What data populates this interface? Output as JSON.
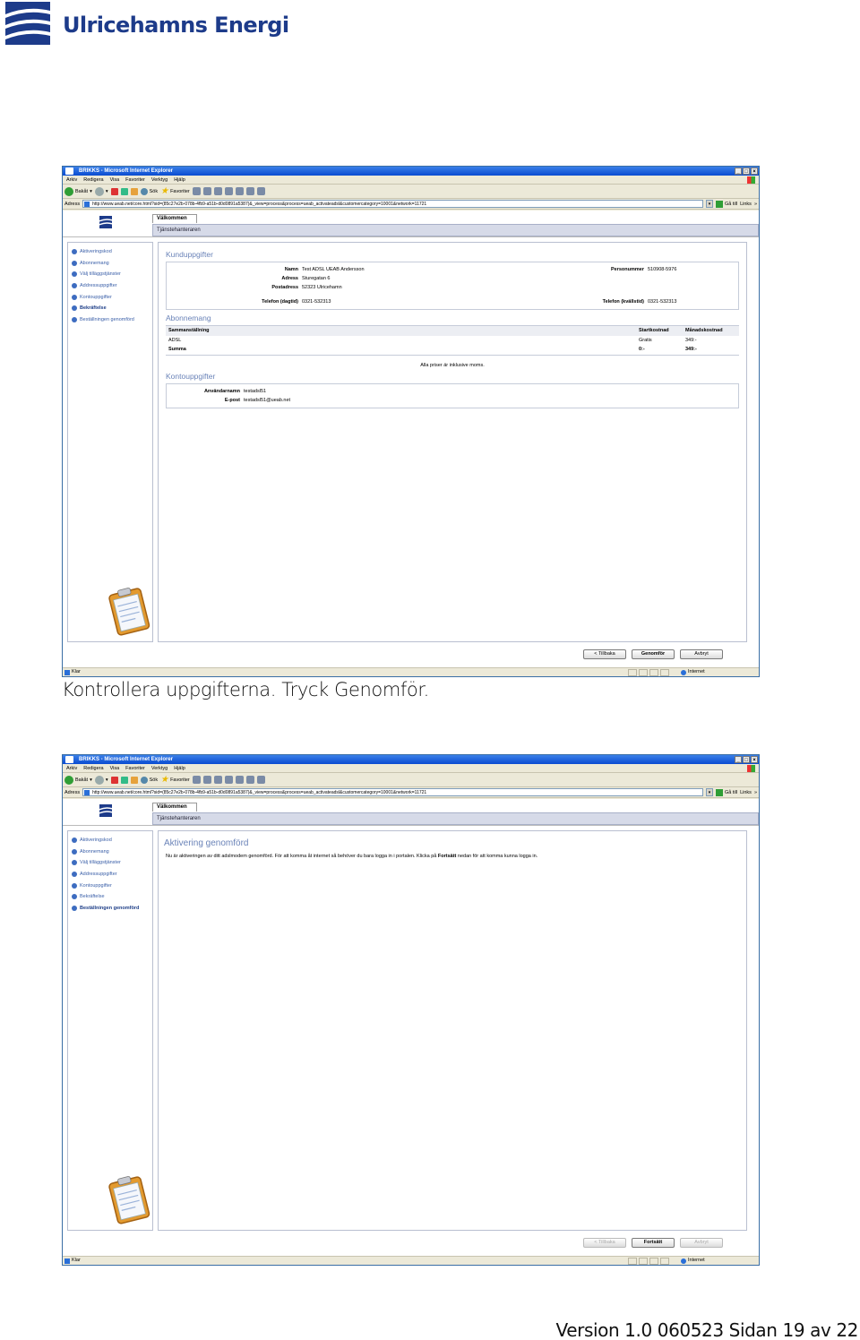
{
  "brand": {
    "name": "Ulricehamns Energi",
    "color": "#1d3b8a"
  },
  "browser": {
    "title": "BRIKKS - Microsoft Internet Explorer",
    "menu": [
      "Arkiv",
      "Redigera",
      "Visa",
      "Favoriter",
      "Verktyg",
      "Hjälp"
    ],
    "toolbar": {
      "back": "Bakåt",
      "search": "Sök",
      "favorites": "Favoriter"
    },
    "address_label": "Adress",
    "url": "http://www.ueab.net/core.html?sid=(85c27e2b-078b-4fb9-a51b-d0d0891a5387)&_view=process&process=ueab_activateadsl&customercategory=10001&network=11721",
    "go_label": "Gå till",
    "links_label": "Links",
    "status_text": "Klar",
    "zone_text": "Internet"
  },
  "portal": {
    "tab": "Välkommen",
    "subtitle": "Tjänstehanteraren",
    "nav": [
      "Aktiveringskod",
      "Abonnemang",
      "Välj tilläggstjänster",
      "Addressuppgifter",
      "Kontouppgifter",
      "Bekräftelse",
      "Beställningen genomförd"
    ]
  },
  "screen1": {
    "customer_section": "Kunduppgifter",
    "name_label": "Namn",
    "name_value": "Test ADSL UEAB Andersson",
    "pnr_label": "Personummer",
    "pnr_value": "510908-5976",
    "address_label": "Adress",
    "address_value": "Sturegatan 6",
    "postal_label": "Postadress",
    "postal_value": "52323 Ulricehamn",
    "phone_day_label": "Telefon (dagtid)",
    "phone_day_value": "0321-532313",
    "phone_eve_label": "Telefon (kvällstid)",
    "phone_eve_value": "0321-532313",
    "subscription_section": "Abonnemang",
    "summary_header": "Sammanställning",
    "start_header": "Startkostnad",
    "monthly_header": "Månadskostnad",
    "item_name": "ADSL",
    "item_start": "Gratis",
    "item_monthly": "349:-",
    "sum_label": "Summa",
    "sum_start": "0:-",
    "sum_monthly": "349:-",
    "vat_note": "Alla priser är inklusive moms.",
    "account_section": "Kontouppgifter",
    "user_label": "Användarnamn",
    "user_value": "testadsl51",
    "email_label": "E-post",
    "email_value": "testadsl51@ueab.net",
    "buttons": {
      "back": "< Tillbaka",
      "submit": "Genomför",
      "cancel": "Avbryt"
    }
  },
  "caption": "Kontrollera uppgifterna. Tryck Genomför.",
  "screen2": {
    "title": "Aktivering genomförd",
    "text_before": "Nu är aktiveringen av ditt adslmodem genomförd. För att komma åt internet så behöver du bara logga in i portalen. Klicka på ",
    "text_bold": "Fortsätt",
    "text_after": " nedan för att komma kunna logga in.",
    "buttons": {
      "back": "< Tillbaka",
      "continue": "Fortsätt",
      "cancel": "Avbryt"
    }
  },
  "footer": "Version 1.0 060523 Sidan 19 av 22"
}
